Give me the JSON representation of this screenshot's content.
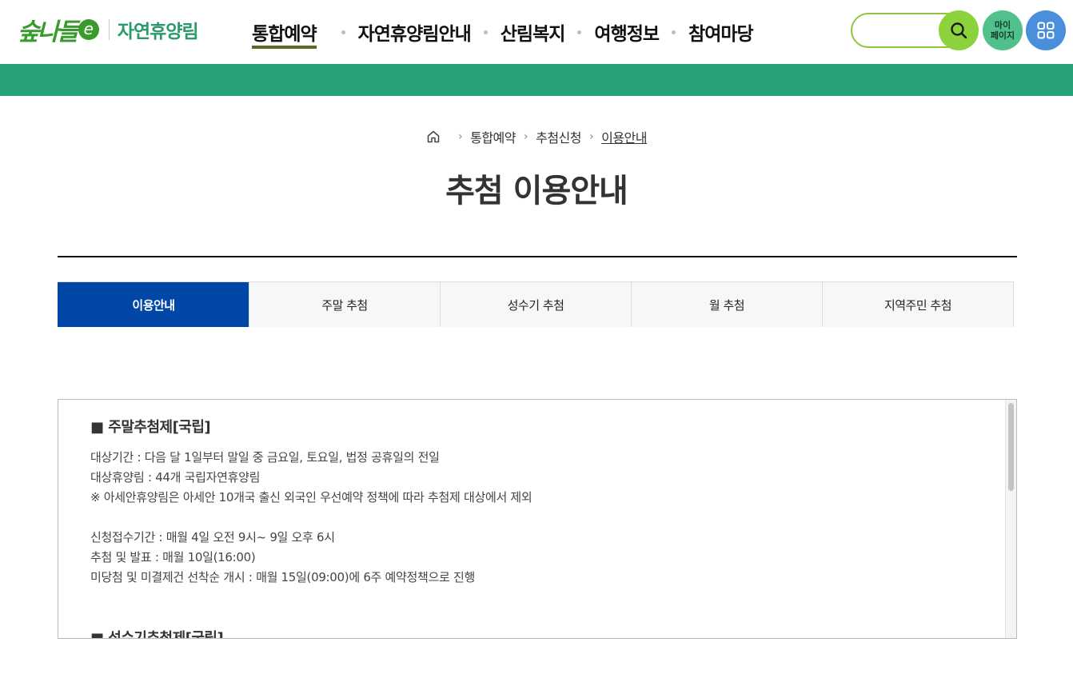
{
  "header": {
    "logo_mark": "숲나들",
    "logo_e": "e",
    "logo_text": "자연휴양림",
    "nav": [
      "통합예약",
      "자연휴양림안내",
      "산림복지",
      "여행정보",
      "참여마당"
    ],
    "active_nav": 0,
    "search": {
      "value": "",
      "placeholder": ""
    },
    "my_page_line1": "마이",
    "my_page_line2": "페이지"
  },
  "breadcrumb": {
    "items": [
      "통합예약",
      "추첨신청",
      "이용안내"
    ]
  },
  "page_title": "추첨 이용안내",
  "tabs": [
    "이용안내",
    "주말 추첨",
    "성수기 추첨",
    "월 추첨",
    "지역주민 추첨"
  ],
  "active_tab": 0,
  "content": {
    "section1_title": "■ 주말추첨제[국립]",
    "section1_lines_a": [
      "대상기간 : 다음 달 1일부터 말일 중 금요일, 토요일, 법정 공휴일의 전일",
      "대상휴양림 : 44개 국립자연휴양림",
      "※ 아세안휴양림은 아세안 10개국 출신 외국인 우선예약 정책에 따라 추첨제 대상에서 제외"
    ],
    "section1_lines_b": [
      "신청접수기간 : 매월 4일 오전 9시~ 9일 오후 6시",
      "추첨 및 발표 : 매월 10일(16:00)",
      "미당첨 및 미결제건 선착순 개시 : 매월 15일(09:00)에 6주 예약정책으로 진행"
    ],
    "section2_title": "■ 성수기추첨제[국립]"
  },
  "colors": {
    "brand_green": "#28a27a",
    "nav_active_underline": "#5a6b1f",
    "tab_active": "#0047a8",
    "search_border": "#8cc63f"
  }
}
